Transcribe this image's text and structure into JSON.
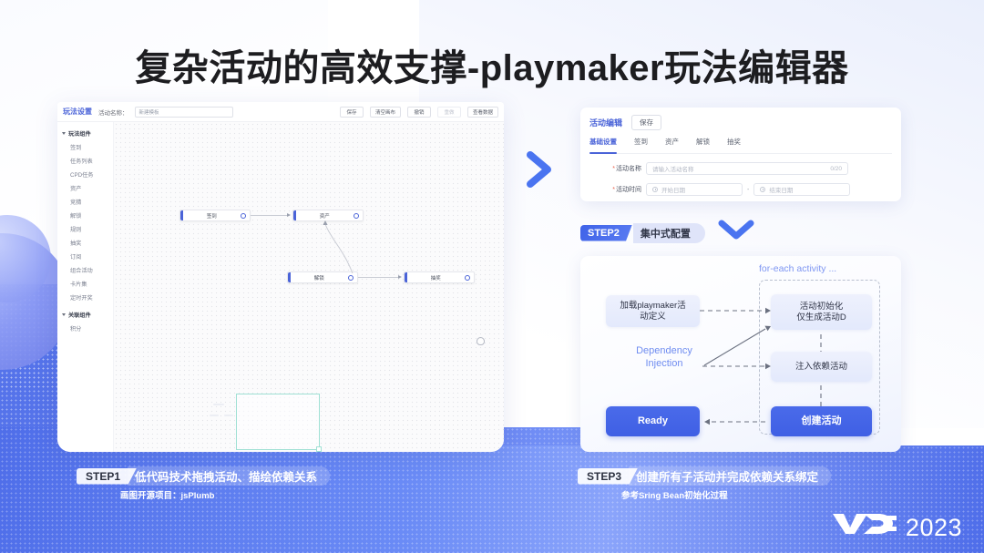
{
  "slide": {
    "title": "复杂活动的高效支撑-playmaker玩法编辑器",
    "logo_mark": "VDC",
    "logo_year": "2023"
  },
  "editor_window": {
    "toolbar": {
      "logo": "玩法设置",
      "name_label": "活动名称：",
      "name_value": "新建模板",
      "buttons": [
        "保存",
        "清空画布",
        "撤销",
        "重做",
        "查看数据"
      ]
    },
    "sidebar": {
      "groups": [
        {
          "label": "玩法组件",
          "items": [
            "签到",
            "任务列表",
            "CPD任务",
            "资产",
            "竞猜",
            "解锁",
            "规则",
            "抽奖",
            "订阅",
            "组合活动",
            "卡片集",
            "定时开奖"
          ]
        },
        {
          "label": "关联组件",
          "items": [
            "积分"
          ]
        }
      ]
    },
    "canvas": {
      "nodes": [
        {
          "label": "签到"
        },
        {
          "label": "资产"
        },
        {
          "label": "解锁"
        },
        {
          "label": "抽奖"
        }
      ]
    }
  },
  "config_card": {
    "title": "活动编辑",
    "save_label": "保存",
    "tabs": [
      "基础设置",
      "签到",
      "资产",
      "解锁",
      "抽奖"
    ],
    "active_tab": "基础设置",
    "fields": {
      "name_label": "活动名称",
      "name_placeholder": "请输入活动名称",
      "name_counter": "0/20",
      "time_label": "活动时间",
      "time_start_placeholder": "开始日期",
      "time_end_placeholder": "结束日期",
      "time_separator": "-"
    }
  },
  "step2": {
    "chip": "STEP2",
    "text": "集中式配置"
  },
  "flow": {
    "group_label": "for-each activity ...",
    "dependency_label": "Dependency\nInjection",
    "nodes": [
      {
        "id": "load",
        "label": "加载playmaker活\n动定义",
        "style": "light"
      },
      {
        "id": "init",
        "label": "活动初始化\n仅生成活动D",
        "style": "light"
      },
      {
        "id": "inject",
        "label": "注入依赖活动",
        "style": "light"
      },
      {
        "id": "create",
        "label": "创建活动",
        "style": "blue"
      },
      {
        "id": "ready",
        "label": "Ready",
        "style": "blue"
      }
    ]
  },
  "step1_banner": {
    "chip": "STEP1",
    "text": "低代码技术拖拽活动、描绘依赖关系",
    "subtext": "画图开源项目：jsPlumb"
  },
  "step3_banner": {
    "chip": "STEP3",
    "text": "创建所有子活动并完成依赖关系绑定",
    "subtext": "参考Sring Bean初始化过程"
  },
  "colors": {
    "accent": "#4a63d8",
    "band": "#5573ea",
    "node_blue": "#4a6bea",
    "dep_text": "#6f8cf0",
    "minimap": "#9fe0d4"
  }
}
